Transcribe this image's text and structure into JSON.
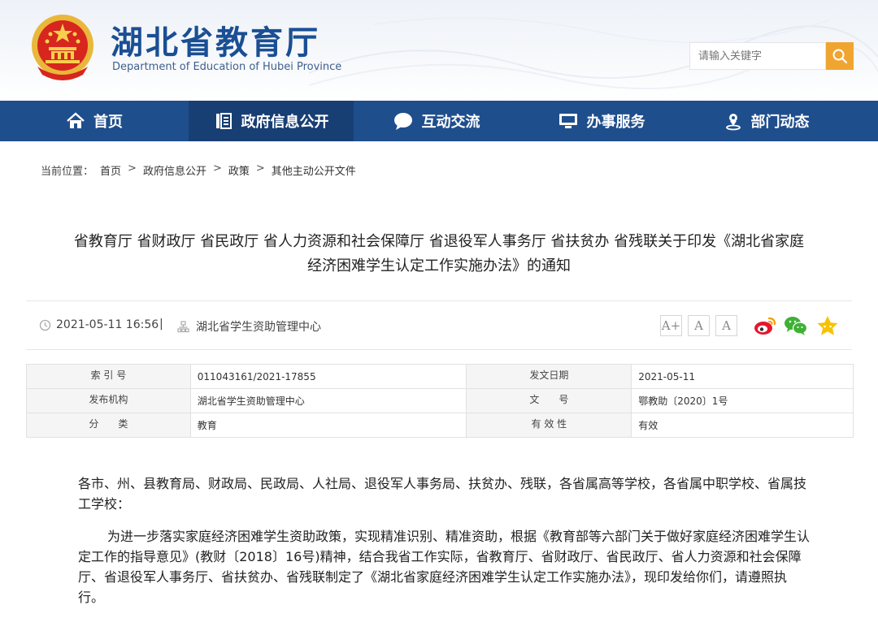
{
  "header": {
    "site_title": "湖北省教育厅",
    "site_subtitle": "Department of Education of Hubei Province",
    "search_placeholder": "请输入关键字"
  },
  "nav": {
    "items": [
      {
        "label": "首页",
        "icon": "home-icon"
      },
      {
        "label": "政府信息公开",
        "icon": "document-list-icon",
        "active": true
      },
      {
        "label": "互动交流",
        "icon": "chat-bubble-icon"
      },
      {
        "label": "办事服务",
        "icon": "monitor-icon"
      },
      {
        "label": "部门动态",
        "icon": "location-person-icon"
      }
    ]
  },
  "breadcrumb": {
    "prefix": "当前位置：",
    "items": [
      "首页",
      "政府信息公开",
      "政策",
      "其他主动公开文件"
    ],
    "separator": ">"
  },
  "article": {
    "title_line1": "省教育厅 省财政厅 省民政厅 省人力资源和社会保障厅 省退役军人事务厅 省扶贫办 省残联关于印发《湖北省家庭",
    "title_line2": "经济困难学生认定工作实施办法》的通知",
    "date": "2021-05-11 16:56",
    "divider": "|",
    "source": "湖北省学生资助管理中心",
    "font_buttons": [
      "A+",
      "A",
      "A"
    ]
  },
  "info_table": {
    "rows": [
      {
        "k1": "索 引 号",
        "v1": "011043161/2021-17855",
        "k2": "发文日期",
        "v2": "2021-05-11"
      },
      {
        "k1": "发布机构",
        "v1": "湖北省学生资助管理中心",
        "k2": "文　　号",
        "v2": "鄂教助〔2020〕1号"
      },
      {
        "k1": "分　　类",
        "v1": "教育",
        "k2": "有 效 性",
        "v2": "有效"
      }
    ]
  },
  "body": {
    "p1": "各市、州、县教育局、财政局、民政局、人社局、退役军人事务局、扶贫办、残联，各省属高等学校，各省属中职学校、省属技工学校：",
    "p2": "为进一步落实家庭经济困难学生资助政策，实现精准识别、精准资助，根据《教育部等六部门关于做好家庭经济困难学生认定工作的指导意见》(教财〔2018〕16号)精神，结合我省工作实际，省教育厅、省财政厅、省民政厅、省人力资源和社会保障厅、省退役军人事务厅、省扶贫办、省残联制定了《湖北省家庭经济困难学生认定工作实施办法》，现印发给你们，请遵照执行。"
  },
  "colors": {
    "nav_bg": "#1f4e8c",
    "nav_active": "#183f74",
    "title_blue": "#1a4f94",
    "search_btn": "#f0a531"
  }
}
